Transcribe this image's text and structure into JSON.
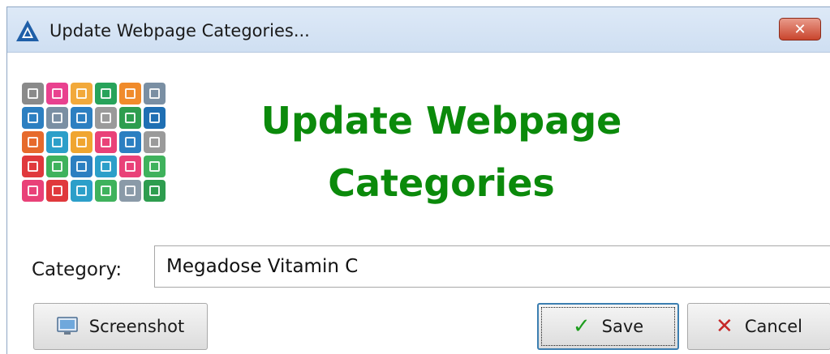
{
  "window": {
    "title": "Update Webpage Categories...",
    "close_glyph": "✕"
  },
  "header": {
    "heading_line1": "Update Webpage",
    "heading_line2": "Categories",
    "icon_tiles": [
      {
        "color": "#8a8a8a"
      },
      {
        "color": "#e9418f"
      },
      {
        "color": "#f2a93b"
      },
      {
        "color": "#27a35a"
      },
      {
        "color": "#f08b2b"
      },
      {
        "color": "#7a8fa3"
      },
      {
        "color": "#2c7fc1"
      },
      {
        "color": "#7a8fa3"
      },
      {
        "color": "#2c7fc1"
      },
      {
        "color": "#9a9a9a"
      },
      {
        "color": "#2e9d4f"
      },
      {
        "color": "#1f6fb3"
      },
      {
        "color": "#e66a2c"
      },
      {
        "color": "#2c9fc9"
      },
      {
        "color": "#f0a530"
      },
      {
        "color": "#e94178"
      },
      {
        "color": "#2c7fc1"
      },
      {
        "color": "#9a9a9a"
      },
      {
        "color": "#e0383c"
      },
      {
        "color": "#3fb25c"
      },
      {
        "color": "#2c7fc1"
      },
      {
        "color": "#2c9fc9"
      },
      {
        "color": "#e94178"
      },
      {
        "color": "#3fb25c"
      },
      {
        "color": "#e94178"
      },
      {
        "color": "#e0383c"
      },
      {
        "color": "#2c9fc9"
      },
      {
        "color": "#3fb25c"
      },
      {
        "color": "#8a9aa8"
      },
      {
        "color": "#2e9d4f"
      }
    ]
  },
  "form": {
    "category_label": "Category:",
    "category_value": "Megadose Vitamin C"
  },
  "buttons": {
    "screenshot_label": "Screenshot",
    "save_label": "Save",
    "cancel_label": "Cancel",
    "save_icon": "check-icon",
    "cancel_icon": "x-icon",
    "screenshot_icon": "monitor-icon"
  },
  "colors": {
    "heading": "#0b8a0b",
    "titlebar": "#d6e4f5",
    "close_button": "#c9452d"
  }
}
